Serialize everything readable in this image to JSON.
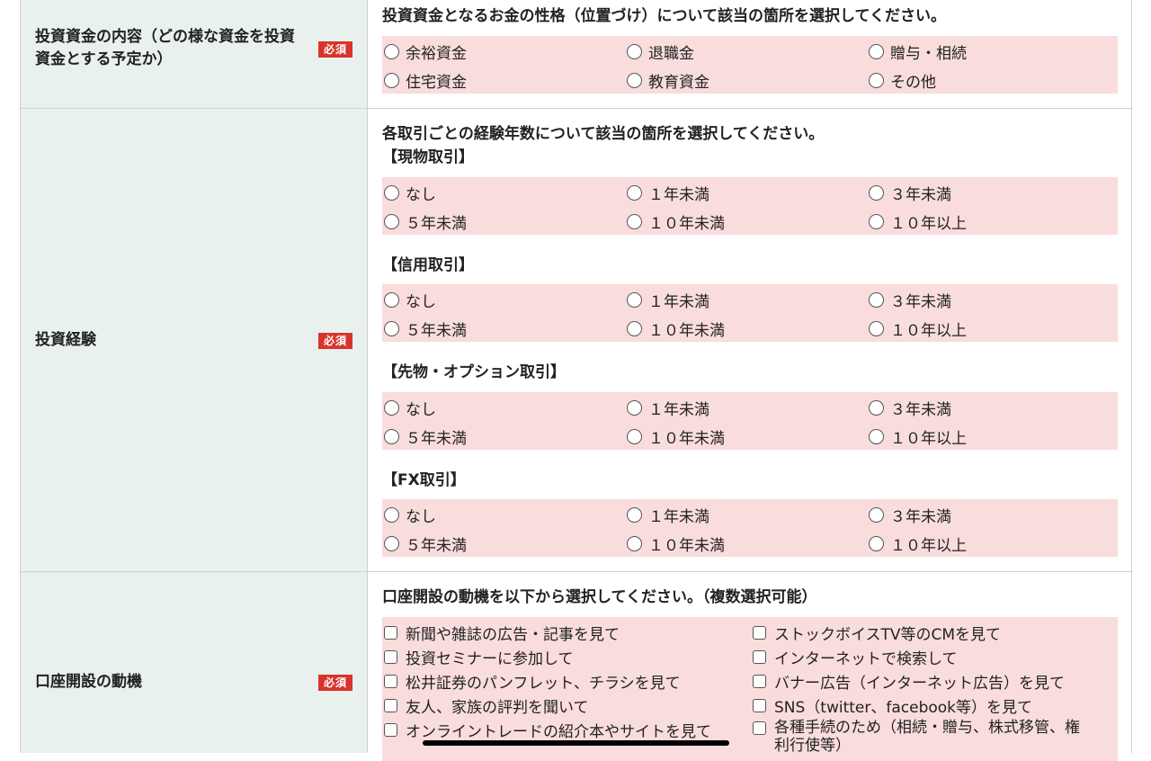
{
  "required_badge": "必須",
  "fund_nature": {
    "label": "投資資金の内容（どの様な資金を投資資金とする予定か）",
    "question": "投資資金となるお金の性格（位置づけ）について該当の箇所を選択してください。",
    "options": [
      "余裕資金",
      "退職金",
      "贈与・相続",
      "住宅資金",
      "教育資金",
      "その他"
    ]
  },
  "experience": {
    "label": "投資経験",
    "question": "各取引ごとの経験年数について該当の箇所を選択してください。",
    "groups": [
      {
        "title": "【現物取引】",
        "options": [
          "なし",
          "１年未満",
          "３年未満",
          "５年未満",
          "１０年未満",
          "１０年以上"
        ]
      },
      {
        "title": "【信用取引】",
        "options": [
          "なし",
          "１年未満",
          "３年未満",
          "５年未満",
          "１０年未満",
          "１０年以上"
        ]
      },
      {
        "title": "【先物・オプション取引】",
        "options": [
          "なし",
          "１年未満",
          "３年未満",
          "５年未満",
          "１０年未満",
          "１０年以上"
        ]
      },
      {
        "title": "【FX取引】",
        "options": [
          "なし",
          "１年未満",
          "３年未満",
          "５年未満",
          "１０年未満",
          "１０年以上"
        ]
      }
    ]
  },
  "motivation": {
    "label": "口座開設の動機",
    "question": "口座開設の動機を以下から選択してください。（複数選択可能）",
    "options": [
      "新聞や雑誌の広告・記事を見て",
      "ストックボイスTV等のCMを見て",
      "投資セミナーに参加して",
      "インターネットで検索して",
      "松井証券のパンフレット、チラシを見て",
      "バナー広告（インターネット広告）を見て",
      "友人、家族の評判を聞いて",
      "SNS（twitter、facebook等）を見て",
      "オンライントレードの紹介本やサイトを見て",
      "各種手続のため（相続・贈与、株式移管、権利行使等）"
    ]
  }
}
